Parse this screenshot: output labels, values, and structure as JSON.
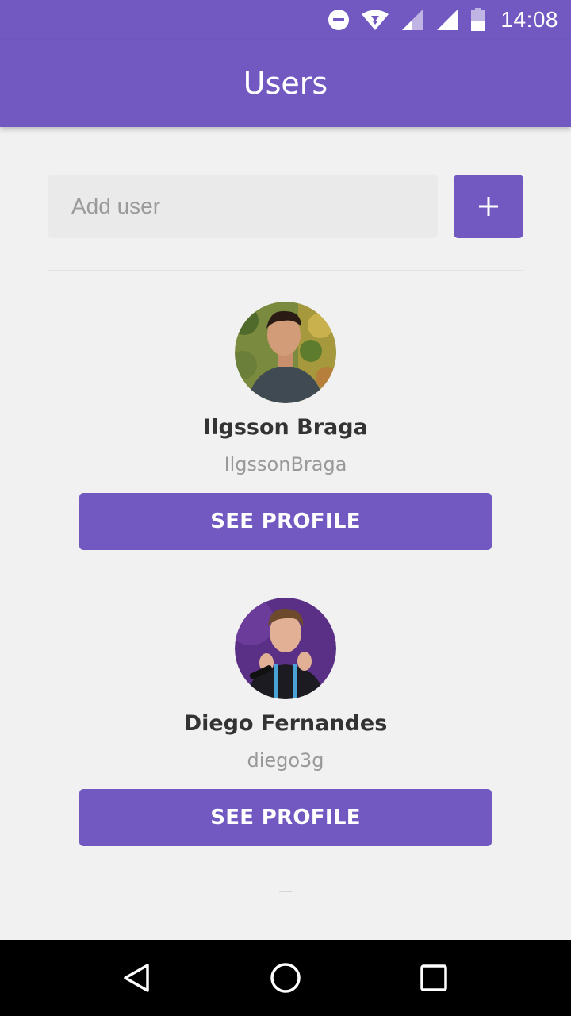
{
  "status_bar": {
    "time": "14:08",
    "icons": [
      "do-not-disturb-icon",
      "wifi-icon",
      "signal-icon",
      "signal-icon",
      "battery-icon"
    ]
  },
  "app_bar": {
    "title": "Users"
  },
  "form": {
    "placeholder": "Add user",
    "add_button_icon": "plus-icon"
  },
  "users": [
    {
      "name": "Ilgsson Braga",
      "login": "IlgssonBraga",
      "button_label": "SEE PROFILE"
    },
    {
      "name": "Diego Fernandes",
      "login": "diego3g",
      "button_label": "SEE PROFILE"
    }
  ],
  "nav_bar": {
    "icons": [
      "back-icon",
      "home-icon",
      "recents-icon"
    ]
  },
  "colors": {
    "primary": "#7159c1",
    "background": "#f1f1f1",
    "name_text": "#333333",
    "login_text": "#999999"
  }
}
